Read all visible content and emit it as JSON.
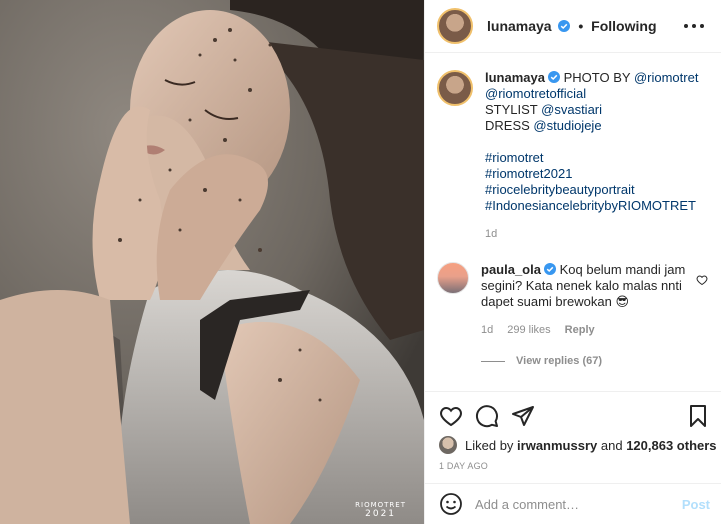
{
  "colors": {
    "link": "#00376b",
    "muted": "#8e8e8e",
    "verified": "#3897f0",
    "post_disabled": "#b2dffc"
  },
  "photo": {
    "watermark_line1": "RIOMOTRET",
    "watermark_line2": "2021"
  },
  "header": {
    "username": "lunamaya",
    "separator": "•",
    "follow_label": "Following",
    "more_icon": "more-options-icon"
  },
  "caption": {
    "username": "lunamaya",
    "text1": "PHOTO BY",
    "mention1": "@riomotret",
    "mention2": "@riomotretofficial",
    "stylist_label": "STYLIST",
    "mention3": "@svastiari",
    "dress_label": "DRESS",
    "mention4": "@studiojeje",
    "hashtags": [
      "#riomotret",
      "#riomotret2021",
      "#riocelebritybeautyportrait",
      "#IndonesiancelebritybyRIOMOTRET"
    ],
    "time": "1d"
  },
  "comment": {
    "username": "paula_ola",
    "text": "Koq belum mandi jam segini? Kata nenek kalo malas nnti dapet suami brewokan",
    "emoji": "😎",
    "time": "1d",
    "likes": "299 likes",
    "reply_label": "Reply",
    "view_replies": "View replies (67)"
  },
  "actions": {
    "liked_by_prefix": "Liked by",
    "liked_by_user": "irwanmussry",
    "liked_by_and": "and",
    "liked_by_count": "120,863 others",
    "date": "1 DAY AGO"
  },
  "add_comment": {
    "placeholder": "Add a comment…",
    "post_label": "Post"
  }
}
